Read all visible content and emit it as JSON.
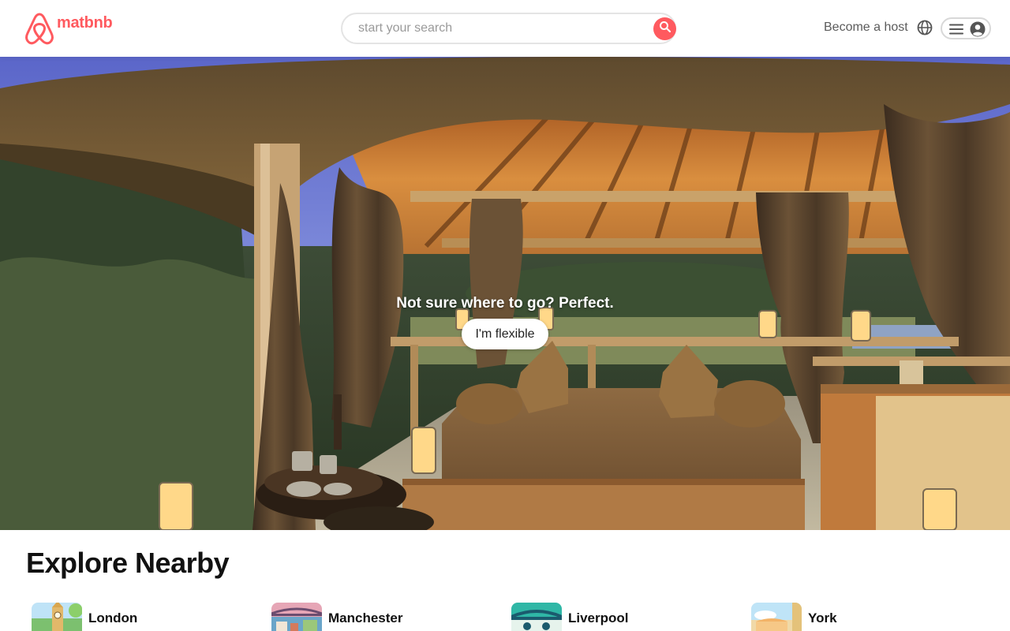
{
  "app": {
    "brand": "matbnb",
    "brand_color": "#FF5A5F"
  },
  "header": {
    "search_placeholder": "start your search",
    "search_icon": "search-icon",
    "host_link": "Become a host",
    "globe_icon": "globe-icon",
    "menu_icon": "hamburger-menu-icon",
    "user_icon": "user-avatar-icon"
  },
  "hero": {
    "title": "Not sure where to go? Perfect.",
    "cta_label": "I'm flexible"
  },
  "explore": {
    "title": "Explore Nearby",
    "items": [
      {
        "name": "London"
      },
      {
        "name": "Manchester"
      },
      {
        "name": "Liverpool"
      },
      {
        "name": "York"
      }
    ]
  }
}
